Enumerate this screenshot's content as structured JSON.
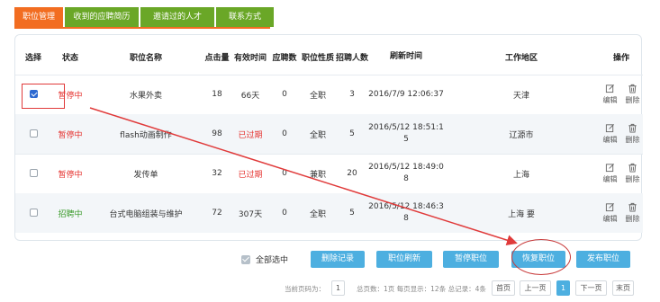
{
  "tabs": [
    {
      "label": "职位管理"
    },
    {
      "label": "收到的应聘简历"
    },
    {
      "label": "邀请过的人才"
    },
    {
      "label": "联系方式"
    }
  ],
  "columns": {
    "select": "选择",
    "status": "状态",
    "name": "职位名称",
    "clicks": "点击量",
    "valid": "有效时间",
    "applied": "应聘数",
    "nature": "职位性质",
    "hires": "招聘人数",
    "refresh": "刷新时间",
    "area": "工作地区",
    "ops": "操作"
  },
  "rows": [
    {
      "status": "暂停中",
      "name": "水果外卖",
      "clicks": "18",
      "valid": "66天",
      "applied": "0",
      "nature": "全职",
      "hires": "3",
      "refresh1": "2016/7/9 12:06:37",
      "refresh2": "",
      "area": "天津",
      "edit": "编辑",
      "del": "删除"
    },
    {
      "status": "暂停中",
      "name": "flash动画制作",
      "clicks": "98",
      "valid": "已过期",
      "applied": "0",
      "nature": "全职",
      "hires": "5",
      "refresh1": "2016/5/12 18:51:1",
      "refresh2": "5",
      "area": "辽源市",
      "edit": "编辑",
      "del": "删除"
    },
    {
      "status": "暂停中",
      "name": "发传单",
      "clicks": "32",
      "valid": "已过期",
      "applied": "0",
      "nature": "兼职",
      "hires": "20",
      "refresh1": "2016/5/12 18:49:0",
      "refresh2": "8",
      "area": "上海",
      "edit": "编辑",
      "del": "删除"
    },
    {
      "status": "招聘中",
      "name": "台式电脑组装与维护",
      "clicks": "72",
      "valid": "307天",
      "applied": "0",
      "nature": "全职",
      "hires": "5",
      "refresh1": "2016/5/12 18:46:3",
      "refresh2": "8",
      "area": "上海 要",
      "edit": "编辑",
      "del": "删除"
    }
  ],
  "actions": {
    "select_all": "全部选中",
    "delete": "删除记录",
    "refresh": "职位刷新",
    "pause": "暂停职位",
    "resume": "恢复职位",
    "publish": "发布职位"
  },
  "pager": {
    "current_label": "当前页码为：",
    "current": "1",
    "summary": "总页数：1页 每页显示：12条 总记录：4条",
    "first": "首页",
    "prev": "上一页",
    "page1": "1",
    "next": "下一页",
    "last": "末页"
  },
  "colors": {
    "active_tab": "#f26d21",
    "tab": "#6aa727",
    "button": "#4dafe0",
    "paused": "#e5312e",
    "recruiting": "#3a9a2a",
    "annotation": "#e03a3a"
  }
}
